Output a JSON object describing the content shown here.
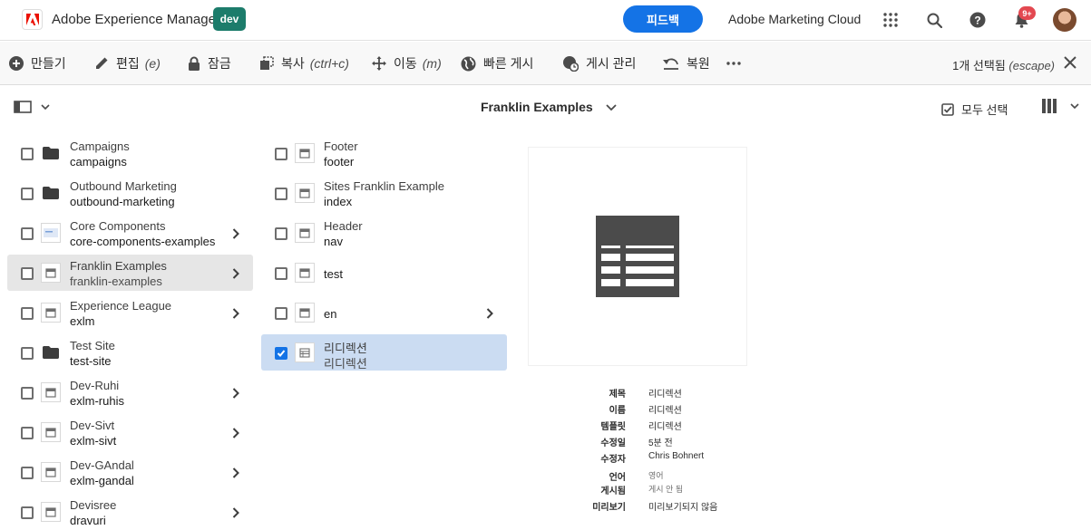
{
  "header": {
    "app_title": "Adobe Experience Manager",
    "env_badge": "dev",
    "feedback_label": "피드백",
    "cloud_label": "Adobe Marketing Cloud",
    "notification_count": "9+"
  },
  "actions": {
    "create": "만들기",
    "edit": "편집",
    "edit_hint": "(e)",
    "lock": "잠금",
    "copy": "복사",
    "copy_hint": "(ctrl+c)",
    "move": "이동",
    "move_hint": "(m)",
    "quick_publish": "빠른 게시",
    "manage_publication": "게시 관리",
    "restore": "복원",
    "selection_count": "1개 선택됨",
    "selection_hint": "(escape)"
  },
  "subbar": {
    "breadcrumb": "Franklin Examples",
    "select_all": "모두 선택"
  },
  "column1": [
    {
      "title": "Campaigns",
      "name": "campaigns"
    },
    {
      "title": "Outbound Marketing",
      "name": "outbound-marketing"
    },
    {
      "title": "Core Components",
      "name": "core-components-examples"
    },
    {
      "title": "Franklin Examples",
      "name": "franklin-examples"
    },
    {
      "title": "Experience League",
      "name": "exlm"
    },
    {
      "title": "Test Site",
      "name": "test-site"
    },
    {
      "title": "Dev-Ruhi",
      "name": "exlm-ruhis"
    },
    {
      "title": "Dev-Sivt",
      "name": "exlm-sivt"
    },
    {
      "title": "Dev-GAndal",
      "name": "exlm-gandal"
    },
    {
      "title": "Devisree",
      "name": "dravuri"
    }
  ],
  "column2": [
    {
      "title": "Footer",
      "name": "footer"
    },
    {
      "title": "Sites Franklin Example",
      "name": "index"
    },
    {
      "title": "Header",
      "name": "nav"
    },
    {
      "title": "test",
      "name": ""
    },
    {
      "title": "en",
      "name": ""
    },
    {
      "title": "리디렉션",
      "name": "리디렉션"
    }
  ],
  "details": {
    "rows": [
      {
        "label": "제목",
        "value": "리디렉션"
      },
      {
        "label": "이름",
        "value": "리디렉션"
      },
      {
        "label": "템플릿",
        "value": "리디렉션"
      },
      {
        "label": "수정일",
        "value": "5분 전"
      },
      {
        "label": "수정자",
        "value": "Chris Bohnert"
      },
      {
        "label": "언어",
        "value": "영어"
      },
      {
        "label": "게시됨",
        "value": "게시 안 됨"
      },
      {
        "label": "미리보기",
        "value": "미리보기되지 않음"
      }
    ]
  },
  "colors": {
    "accent": "#1473e6",
    "env_badge": "#1c7c6b",
    "selected_row": "#cbdcf2",
    "active_row": "#e6e6e6",
    "notification": "#e34850"
  }
}
